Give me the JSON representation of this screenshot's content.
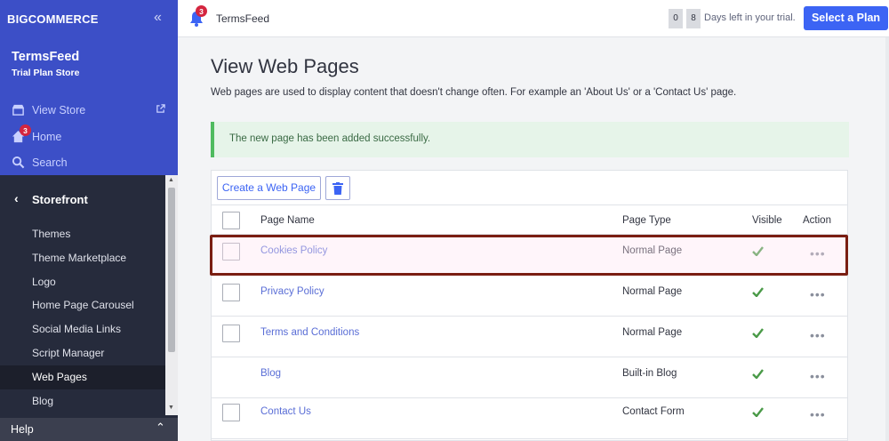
{
  "sidebar": {
    "logo": "BIGCOMMERCE",
    "store_name": "TermsFeed",
    "store_plan": "Trial Plan Store",
    "links": {
      "view_store": "View Store",
      "home": "Home",
      "home_badge": "3",
      "search": "Search"
    },
    "section": "Storefront",
    "items": [
      {
        "label": "Themes"
      },
      {
        "label": "Theme Marketplace"
      },
      {
        "label": "Logo"
      },
      {
        "label": "Home Page Carousel"
      },
      {
        "label": "Social Media Links"
      },
      {
        "label": "Script Manager"
      },
      {
        "label": "Web Pages"
      },
      {
        "label": "Blog"
      }
    ],
    "help": "Help"
  },
  "topbar": {
    "notification_count": "3",
    "store_name": "TermsFeed",
    "days_digits": [
      "0",
      "8"
    ],
    "trial_text": "Days left in your trial.",
    "plan_button": "Select a Plan"
  },
  "main": {
    "title": "View Web Pages",
    "subtitle": "Web pages are used to display content that doesn't change often. For example an 'About Us' or a 'Contact Us' page.",
    "alert": "The new page has been added successfully.",
    "create_button": "Create a Web Page",
    "columns": {
      "name": "Page Name",
      "type": "Page Type",
      "visible": "Visible",
      "action": "Action"
    },
    "rows": [
      {
        "name": "Cookies Policy",
        "type": "Normal Page",
        "action": "•••"
      },
      {
        "name": "Privacy Policy",
        "type": "Normal Page",
        "action": "•••"
      },
      {
        "name": "Terms and Conditions",
        "type": "Normal Page",
        "action": "•••"
      },
      {
        "name": "Blog",
        "type": "Built-in Blog",
        "action": "•••"
      },
      {
        "name": "Contact Us",
        "type": "Contact Form",
        "action": "•••"
      }
    ]
  },
  "colors": {
    "brand_blue": "#3c4fc7",
    "primary_button": "#3c64f4",
    "sidebar_dark": "#262b3c",
    "success_border": "#4fbb5f",
    "highlight_border": "#7a1e12"
  }
}
